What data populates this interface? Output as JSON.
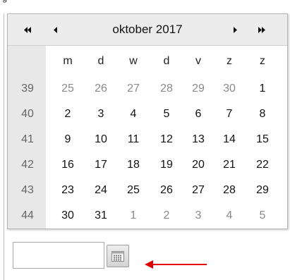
{
  "calendar": {
    "month_title": "oktober 2017",
    "nav": {
      "prev_year_icon": "double-chevron-left-icon",
      "prev_month_icon": "chevron-left-icon",
      "next_month_icon": "chevron-right-icon",
      "next_year_icon": "double-chevron-right-icon"
    },
    "weekday_headers": [
      "m",
      "d",
      "w",
      "d",
      "v",
      "z",
      "z"
    ],
    "weeks": [
      {
        "week": "39",
        "days": [
          "25",
          "26",
          "27",
          "28",
          "29",
          "30",
          "1"
        ],
        "other_month": [
          true,
          true,
          true,
          true,
          true,
          true,
          false
        ]
      },
      {
        "week": "40",
        "days": [
          "2",
          "3",
          "4",
          "5",
          "6",
          "7",
          "8"
        ],
        "other_month": [
          false,
          false,
          false,
          false,
          false,
          false,
          false
        ]
      },
      {
        "week": "41",
        "days": [
          "9",
          "10",
          "11",
          "12",
          "13",
          "14",
          "15"
        ],
        "other_month": [
          false,
          false,
          false,
          false,
          false,
          false,
          false
        ]
      },
      {
        "week": "42",
        "days": [
          "16",
          "17",
          "18",
          "19",
          "20",
          "21",
          "22"
        ],
        "other_month": [
          false,
          false,
          false,
          false,
          false,
          false,
          false
        ]
      },
      {
        "week": "43",
        "days": [
          "23",
          "24",
          "25",
          "26",
          "27",
          "28",
          "29"
        ],
        "other_month": [
          false,
          false,
          false,
          false,
          false,
          false,
          false
        ]
      },
      {
        "week": "44",
        "days": [
          "30",
          "31",
          "1",
          "2",
          "3",
          "4",
          "5"
        ],
        "other_month": [
          false,
          false,
          true,
          true,
          true,
          true,
          true
        ]
      }
    ]
  },
  "date_field": {
    "value": "",
    "placeholder": ""
  },
  "calendar_button_icon": "calendar-icon",
  "annotation_arrow_color": "#e00000"
}
